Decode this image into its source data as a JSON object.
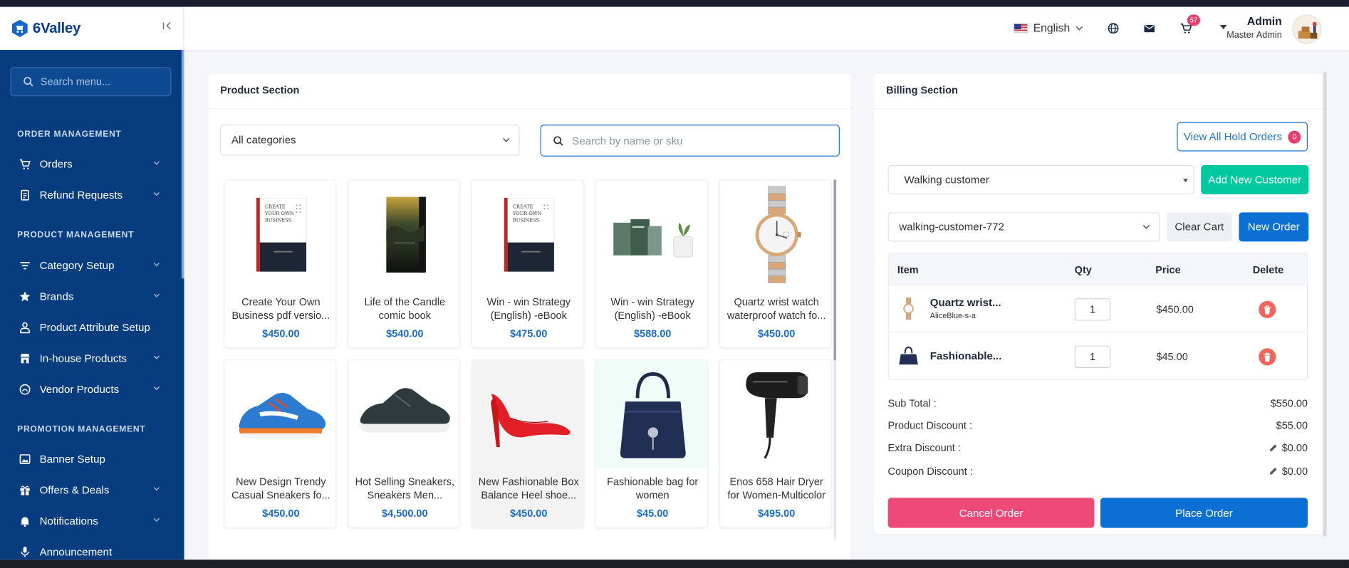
{
  "brand": {
    "name": "6Valley"
  },
  "sidebar": {
    "search_placeholder": "Search menu...",
    "sections": [
      {
        "title": "ORDER MANAGEMENT"
      },
      {
        "title": "PRODUCT MANAGEMENT"
      },
      {
        "title": "PROMOTION MANAGEMENT"
      }
    ],
    "items": [
      {
        "label": "Orders",
        "icon": "cart-icon"
      },
      {
        "label": "Refund Requests",
        "icon": "refund-icon"
      },
      {
        "label": "Category Setup",
        "icon": "filter-icon"
      },
      {
        "label": "Brands",
        "icon": "star-icon"
      },
      {
        "label": "Product Attribute Setup",
        "icon": "attribute-icon"
      },
      {
        "label": "In-house Products",
        "icon": "store-icon"
      },
      {
        "label": "Vendor Products",
        "icon": "vendor-icon"
      },
      {
        "label": "Banner Setup",
        "icon": "image-icon"
      },
      {
        "label": "Offers & Deals",
        "icon": "gift-icon"
      },
      {
        "label": "Notifications",
        "icon": "bell-icon"
      },
      {
        "label": "Announcement",
        "icon": "mic-icon"
      }
    ]
  },
  "header": {
    "language": "English",
    "cart_count": "57",
    "admin_name": "Admin",
    "admin_role": "Master Admin"
  },
  "product_section": {
    "title": "Product Section",
    "category_selected": "All categories",
    "search_placeholder": "Search by name or sku",
    "products": [
      {
        "line1": "Create Your Own",
        "line2": "Business pdf versio...",
        "price": "$450.00"
      },
      {
        "line1": "Life of the Candle",
        "line2": "comic book",
        "price": "$540.00"
      },
      {
        "line1": "Win - win Strategy",
        "line2": "(English) -eBook",
        "price": "$475.00"
      },
      {
        "line1": "Win - win Strategy",
        "line2": "(English) -eBook",
        "price": "$588.00"
      },
      {
        "line1": "Quartz wrist watch",
        "line2": "waterproof watch fo...",
        "price": "$450.00"
      },
      {
        "line1": "New Design Trendy",
        "line2": "Casual Sneakers fo...",
        "price": "$450.00"
      },
      {
        "line1": "Hot Selling Sneakers,",
        "line2": "Sneakers Men...",
        "price": "$4,500.00"
      },
      {
        "line1": "New Fashionable Box",
        "line2": "Balance Heel shoe...",
        "price": "$450.00"
      },
      {
        "line1": "Fashionable bag for",
        "line2": "women",
        "price": "$45.00"
      },
      {
        "line1": "Enos 658 Hair Dryer",
        "line2": "for Women-Multicolor",
        "price": "$495.00"
      }
    ],
    "book_cover_text": [
      "CREATE",
      "YOUR OWN",
      "BUSINESS"
    ]
  },
  "billing": {
    "title": "Billing Section",
    "hold_orders_label": "View All Hold Orders",
    "hold_orders_count": "0",
    "customer_selected": "Walking customer",
    "add_customer_label": "Add New Customer",
    "order_selected": "walking-customer-772",
    "clear_cart_label": "Clear Cart",
    "new_order_label": "New Order",
    "table": {
      "headers": [
        "Item",
        "Qty",
        "Price",
        "Delete"
      ],
      "rows": [
        {
          "name": "Quartz wrist...",
          "variant": "AliceBlue-s-a",
          "qty": "1",
          "price": "$450.00"
        },
        {
          "name": "Fashionable...",
          "variant": "",
          "qty": "1",
          "price": "$45.00"
        }
      ]
    },
    "summary": [
      {
        "label": "Sub Total :",
        "value": "$550.00"
      },
      {
        "label": "Product Discount :",
        "value": "$55.00"
      },
      {
        "label": "Extra Discount :",
        "value": "$0.00"
      },
      {
        "label": "Coupon Discount :",
        "value": "$0.00"
      }
    ],
    "cancel_label": "Cancel Order",
    "place_label": "Place Order"
  },
  "colors": {
    "sidebar_bg": "#073d7f",
    "primary": "#0b6fd3",
    "accent_green": "#00c9a0",
    "danger": "#ee4a79",
    "price_blue": "#1b6dc4"
  }
}
